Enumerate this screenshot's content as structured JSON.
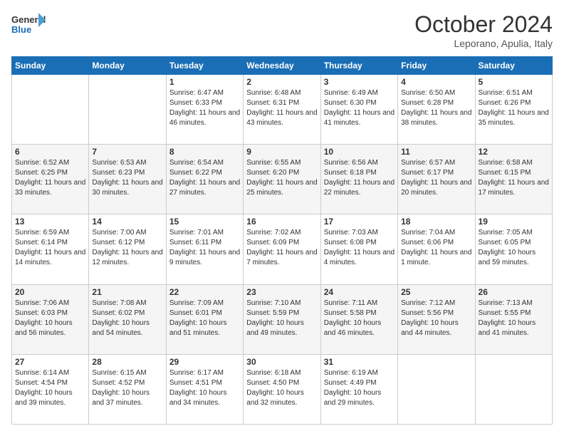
{
  "header": {
    "logo_general": "General",
    "logo_blue": "Blue",
    "month": "October 2024",
    "location": "Leporano, Apulia, Italy"
  },
  "weekdays": [
    "Sunday",
    "Monday",
    "Tuesday",
    "Wednesday",
    "Thursday",
    "Friday",
    "Saturday"
  ],
  "weeks": [
    [
      {
        "day": "",
        "info": ""
      },
      {
        "day": "",
        "info": ""
      },
      {
        "day": "1",
        "info": "Sunrise: 6:47 AM\nSunset: 6:33 PM\nDaylight: 11 hours and 46 minutes."
      },
      {
        "day": "2",
        "info": "Sunrise: 6:48 AM\nSunset: 6:31 PM\nDaylight: 11 hours and 43 minutes."
      },
      {
        "day": "3",
        "info": "Sunrise: 6:49 AM\nSunset: 6:30 PM\nDaylight: 11 hours and 41 minutes."
      },
      {
        "day": "4",
        "info": "Sunrise: 6:50 AM\nSunset: 6:28 PM\nDaylight: 11 hours and 38 minutes."
      },
      {
        "day": "5",
        "info": "Sunrise: 6:51 AM\nSunset: 6:26 PM\nDaylight: 11 hours and 35 minutes."
      }
    ],
    [
      {
        "day": "6",
        "info": "Sunrise: 6:52 AM\nSunset: 6:25 PM\nDaylight: 11 hours and 33 minutes."
      },
      {
        "day": "7",
        "info": "Sunrise: 6:53 AM\nSunset: 6:23 PM\nDaylight: 11 hours and 30 minutes."
      },
      {
        "day": "8",
        "info": "Sunrise: 6:54 AM\nSunset: 6:22 PM\nDaylight: 11 hours and 27 minutes."
      },
      {
        "day": "9",
        "info": "Sunrise: 6:55 AM\nSunset: 6:20 PM\nDaylight: 11 hours and 25 minutes."
      },
      {
        "day": "10",
        "info": "Sunrise: 6:56 AM\nSunset: 6:18 PM\nDaylight: 11 hours and 22 minutes."
      },
      {
        "day": "11",
        "info": "Sunrise: 6:57 AM\nSunset: 6:17 PM\nDaylight: 11 hours and 20 minutes."
      },
      {
        "day": "12",
        "info": "Sunrise: 6:58 AM\nSunset: 6:15 PM\nDaylight: 11 hours and 17 minutes."
      }
    ],
    [
      {
        "day": "13",
        "info": "Sunrise: 6:59 AM\nSunset: 6:14 PM\nDaylight: 11 hours and 14 minutes."
      },
      {
        "day": "14",
        "info": "Sunrise: 7:00 AM\nSunset: 6:12 PM\nDaylight: 11 hours and 12 minutes."
      },
      {
        "day": "15",
        "info": "Sunrise: 7:01 AM\nSunset: 6:11 PM\nDaylight: 11 hours and 9 minutes."
      },
      {
        "day": "16",
        "info": "Sunrise: 7:02 AM\nSunset: 6:09 PM\nDaylight: 11 hours and 7 minutes."
      },
      {
        "day": "17",
        "info": "Sunrise: 7:03 AM\nSunset: 6:08 PM\nDaylight: 11 hours and 4 minutes."
      },
      {
        "day": "18",
        "info": "Sunrise: 7:04 AM\nSunset: 6:06 PM\nDaylight: 11 hours and 1 minute."
      },
      {
        "day": "19",
        "info": "Sunrise: 7:05 AM\nSunset: 6:05 PM\nDaylight: 10 hours and 59 minutes."
      }
    ],
    [
      {
        "day": "20",
        "info": "Sunrise: 7:06 AM\nSunset: 6:03 PM\nDaylight: 10 hours and 56 minutes."
      },
      {
        "day": "21",
        "info": "Sunrise: 7:08 AM\nSunset: 6:02 PM\nDaylight: 10 hours and 54 minutes."
      },
      {
        "day": "22",
        "info": "Sunrise: 7:09 AM\nSunset: 6:01 PM\nDaylight: 10 hours and 51 minutes."
      },
      {
        "day": "23",
        "info": "Sunrise: 7:10 AM\nSunset: 5:59 PM\nDaylight: 10 hours and 49 minutes."
      },
      {
        "day": "24",
        "info": "Sunrise: 7:11 AM\nSunset: 5:58 PM\nDaylight: 10 hours and 46 minutes."
      },
      {
        "day": "25",
        "info": "Sunrise: 7:12 AM\nSunset: 5:56 PM\nDaylight: 10 hours and 44 minutes."
      },
      {
        "day": "26",
        "info": "Sunrise: 7:13 AM\nSunset: 5:55 PM\nDaylight: 10 hours and 41 minutes."
      }
    ],
    [
      {
        "day": "27",
        "info": "Sunrise: 6:14 AM\nSunset: 4:54 PM\nDaylight: 10 hours and 39 minutes."
      },
      {
        "day": "28",
        "info": "Sunrise: 6:15 AM\nSunset: 4:52 PM\nDaylight: 10 hours and 37 minutes."
      },
      {
        "day": "29",
        "info": "Sunrise: 6:17 AM\nSunset: 4:51 PM\nDaylight: 10 hours and 34 minutes."
      },
      {
        "day": "30",
        "info": "Sunrise: 6:18 AM\nSunset: 4:50 PM\nDaylight: 10 hours and 32 minutes."
      },
      {
        "day": "31",
        "info": "Sunrise: 6:19 AM\nSunset: 4:49 PM\nDaylight: 10 hours and 29 minutes."
      },
      {
        "day": "",
        "info": ""
      },
      {
        "day": "",
        "info": ""
      }
    ]
  ]
}
